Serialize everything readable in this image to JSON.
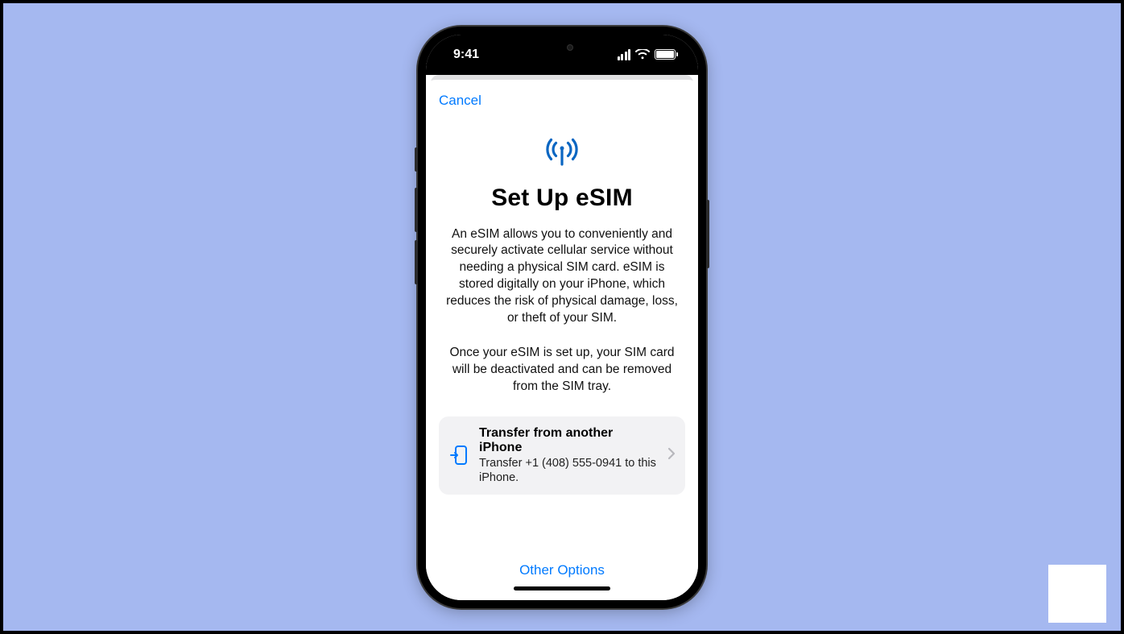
{
  "status": {
    "time": "9:41"
  },
  "nav": {
    "cancel_label": "Cancel"
  },
  "page": {
    "title": "Set Up eSIM",
    "description1": "An eSIM allows you to conveniently and securely activate cellular service without needing a physical SIM card. eSIM is stored digitally on your iPhone, which reduces the risk of physical damage, loss, or theft of your SIM.",
    "description2": "Once your eSIM is set up, your SIM card will be deactivated and can be removed from the SIM tray."
  },
  "option": {
    "title": "Transfer from another iPhone",
    "subtitle": "Transfer +1 (408) 555-0941 to this iPhone."
  },
  "footer": {
    "other_options_label": "Other Options"
  }
}
